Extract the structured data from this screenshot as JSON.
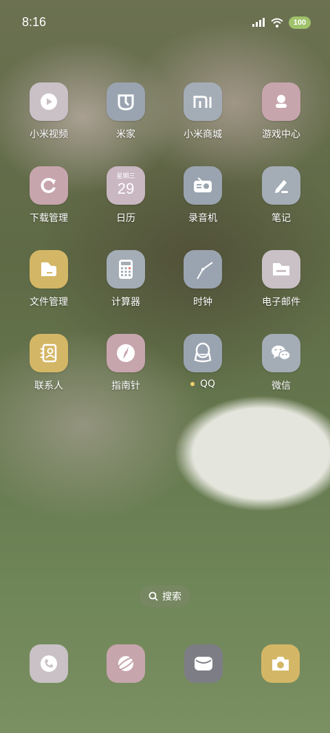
{
  "status_bar": {
    "time": "8:16",
    "battery": "100"
  },
  "apps": [
    {
      "label": "小米视频",
      "icon": "play-icon",
      "color": "#c9c1c6"
    },
    {
      "label": "米家",
      "icon": "mijia-icon",
      "color": "#9aa4b0"
    },
    {
      "label": "小米商城",
      "icon": "mi-logo-icon",
      "color": "#a4adb6"
    },
    {
      "label": "游戏中心",
      "icon": "gamepad-icon",
      "color": "#c7a5ad"
    },
    {
      "label": "下载管理",
      "icon": "refresh-icon",
      "color": "#c7a5ad"
    },
    {
      "label": "日历",
      "icon": "calendar-icon",
      "color": "#c9b7c2",
      "weekday": "星期三",
      "day": "29"
    },
    {
      "label": "录音机",
      "icon": "radio-icon",
      "color": "#9aa4b0"
    },
    {
      "label": "笔记",
      "icon": "pen-icon",
      "color": "#a4adb6"
    },
    {
      "label": "文件管理",
      "icon": "folder-icon",
      "color": "#d4b766"
    },
    {
      "label": "计算器",
      "icon": "calculator-icon",
      "color": "#a4adb6"
    },
    {
      "label": "时钟",
      "icon": "clock-icon",
      "color": "#9aa4b0"
    },
    {
      "label": "电子邮件",
      "icon": "mail-folder-icon",
      "color": "#c9c1c6"
    },
    {
      "label": "联系人",
      "icon": "contacts-icon",
      "color": "#d4b766"
    },
    {
      "label": "指南针",
      "icon": "compass-icon",
      "color": "#c7a5ad"
    },
    {
      "label": "QQ",
      "icon": "qq-penguin-icon",
      "color": "#9aa4b0"
    },
    {
      "label": "微信",
      "icon": "wechat-icon",
      "color": "#a4adb6"
    }
  ],
  "search": {
    "label": "搜索"
  },
  "dock": [
    {
      "icon": "phone-icon",
      "color": "#c9c1c6"
    },
    {
      "icon": "browser-icon",
      "color": "#c7a5ad"
    },
    {
      "icon": "message-icon",
      "color": "#7d7d86"
    },
    {
      "icon": "camera-icon",
      "color": "#d4b766"
    }
  ]
}
